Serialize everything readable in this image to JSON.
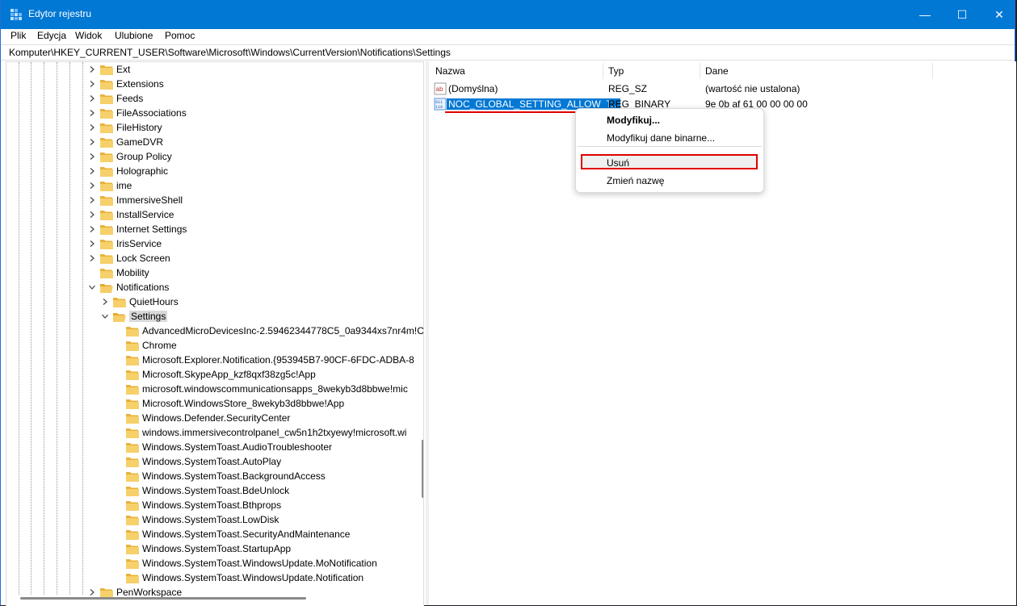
{
  "window": {
    "title": "Edytor rejestru",
    "controls": {
      "minimize": "—",
      "maximize": "☐",
      "close": "✕"
    }
  },
  "menu": [
    "Plik",
    "Edycja",
    "Widok",
    "Ulubione",
    "Pomoc"
  ],
  "address": "Komputer\\HKEY_CURRENT_USER\\Software\\Microsoft\\Windows\\CurrentVersion\\Notifications\\Settings",
  "tree": {
    "top_level": [
      "Ext",
      "Extensions",
      "Feeds",
      "FileAssociations",
      "FileHistory",
      "GameDVR",
      "Group Policy",
      "Holographic",
      "ime",
      "ImmersiveShell",
      "InstallService",
      "Internet Settings",
      "IrisService",
      "Lock Screen",
      "Mobility",
      "Notifications"
    ],
    "notifications_children": [
      "QuietHours",
      "Settings"
    ],
    "settings_children": [
      "AdvancedMicroDevicesInc-2.59462344778C5_0a9344xs7nr4m!C",
      "Chrome",
      "Microsoft.Explorer.Notification.{953945B7-90CF-6FDC-ADBA-8",
      "Microsoft.SkypeApp_kzf8qxf38zg5c!App",
      "microsoft.windowscommunicationsapps_8wekyb3d8bbwe!mic",
      "Microsoft.WindowsStore_8wekyb3d8bbwe!App",
      "Windows.Defender.SecurityCenter",
      "windows.immersivecontrolpanel_cw5n1h2txyewy!microsoft.wi",
      "Windows.SystemToast.AudioTroubleshooter",
      "Windows.SystemToast.AutoPlay",
      "Windows.SystemToast.BackgroundAccess",
      "Windows.SystemToast.BdeUnlock",
      "Windows.SystemToast.Bthprops",
      "Windows.SystemToast.LowDisk",
      "Windows.SystemToast.SecurityAndMaintenance",
      "Windows.SystemToast.StartupApp",
      "Windows.SystemToast.WindowsUpdate.MoNotification",
      "Windows.SystemToast.WindowsUpdate.Notification"
    ],
    "partial_bottom": "PenWorkspace"
  },
  "columns": {
    "name": "Nazwa",
    "type": "Typ",
    "data": "Dane"
  },
  "values": [
    {
      "name": "(Domyślna)",
      "type": "REG_SZ",
      "data": "(wartość nie ustalona)",
      "icon": "string-value-icon"
    },
    {
      "name": "NOC_GLOBAL_SETTING_ALLOW_T...",
      "type": "REG_BINARY",
      "data": "9e 0b af 61 00 00 00 00",
      "icon": "binary-value-icon"
    }
  ],
  "context_menu": {
    "modify": "Modyfikuj...",
    "modify_binary": "Modyfikuj dane binarne...",
    "delete": "Usuń",
    "rename": "Zmień nazwę"
  },
  "colors": {
    "accent": "#0078d4",
    "highlight_red": "#e00000",
    "folder": "#f2c65a"
  }
}
